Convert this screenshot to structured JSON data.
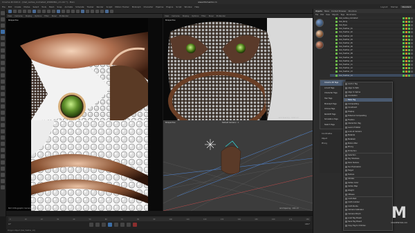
{
  "window": {
    "title": "Cinema 4D R20.0 - [Owl_Ladies_Animated_WORKING_v3.c4d *] - Main",
    "watermark_site": "www.Momentor.cn"
  },
  "menu": {
    "items": [
      "File",
      "Edit",
      "Create",
      "Modes",
      "Select",
      "Tools",
      "Mesh",
      "Snap",
      "Animate",
      "Simulate",
      "Tracker",
      "Render",
      "Sculpt",
      "Motion Tracker",
      "MoGraph",
      "Character",
      "Pipeline",
      "Plugins",
      "Script",
      "Window",
      "Help"
    ],
    "layouts": [
      "Layout:",
      "Startup",
      "Standard"
    ],
    "layout_active": "Standard"
  },
  "viewports": {
    "top_left": {
      "label": "Perspective",
      "menu": [
        "View",
        "Cameras",
        "Display",
        "Options",
        "Filter",
        "Panel",
        "ProRender"
      ]
    },
    "top_right": {
      "label": "Perspective",
      "footer": "Grid Spacing : 1000 cm"
    },
    "bottom_left": {
      "label": "Perspective",
      "footer": "Bird Orthographic Camera : 100 cm"
    },
    "bottom_right": {
      "label": "Perspective",
      "camera_label": "Default Camera :: 1",
      "footer": "Grid Spacing : 100 cm"
    }
  },
  "object_manager": {
    "tabs": [
      "Objects",
      "Takes",
      "Content Browser",
      "Structure"
    ],
    "menu": [
      "File",
      "Edit",
      "View",
      "Objects",
      "Tags",
      "Bookmarks"
    ],
    "rows": [
      {
        "name": "Owl_Ladies_Animated",
        "sel": false
      },
      {
        "name": "Owl_Body",
        "sel": false
      },
      {
        "name": "Owl_Eyes",
        "sel": false
      },
      {
        "name": "Owl_Feather_01",
        "sel": false
      },
      {
        "name": "Owl_Feather_02",
        "sel": false
      },
      {
        "name": "Owl_Feather_03",
        "sel": false
      },
      {
        "name": "Owl_Feather_04",
        "sel": false
      },
      {
        "name": "Owl_Feather_05",
        "sel": false
      },
      {
        "name": "Owl_Feather_06",
        "sel": false
      },
      {
        "name": "Owl_Feather_07",
        "sel": false
      },
      {
        "name": "Owl_Feather_08",
        "sel": false
      },
      {
        "name": "Owl_Feather_09",
        "sel": false
      },
      {
        "name": "Owl_Feather_10",
        "sel": false
      },
      {
        "name": "Owl_Feather_11",
        "sel": false
      },
      {
        "name": "Owl_Feather_12",
        "sel": false
      },
      {
        "name": "Owl_Feather_13",
        "sel": false
      },
      {
        "name": "Owl_Feather_14",
        "sel": true
      }
    ]
  },
  "attributes": {
    "submenu": [
      "Cinema 4D Tags",
      "Arnold Tags",
      "Character Tags",
      "Hair Tags",
      "MoGraph Tags",
      "Octane Tags",
      "Redshift Tags",
      "Simulation Tags",
      "Sketch Tags"
    ],
    "side_labels": [
      "Coordinates",
      "Object",
      "Phong"
    ]
  },
  "context_menu": {
    "items": [
      {
        "label": "Anchor Tag",
        "hl": false,
        "sep": false
      },
      {
        "label": "Align to Path",
        "hl": false,
        "sep": false
      },
      {
        "label": "Align to Spline",
        "hl": false,
        "sep": false
      },
      {
        "label": "Annotation",
        "hl": false,
        "sep": false
      },
      {
        "label": "Bake Tag",
        "hl": true,
        "sep": false
      },
      {
        "label": "Compositing",
        "hl": false,
        "sep": false
      },
      {
        "label": "Constraint",
        "hl": false,
        "sep": false
      },
      {
        "label": "Display",
        "hl": false,
        "sep": false
      },
      {
        "label": "External Compositing",
        "hl": false,
        "sep": false
      },
      {
        "label": "Fixation",
        "hl": false,
        "sep": false
      },
      {
        "label": "Interaction Tag",
        "hl": false,
        "sep": false
      },
      {
        "label": "Level of Detail",
        "hl": false,
        "sep": false
      },
      {
        "label": "Look at Camera",
        "hl": false,
        "sep": false
      },
      {
        "label": "Material",
        "hl": false,
        "sep": false
      },
      {
        "label": "Metaball",
        "hl": false,
        "sep": false
      },
      {
        "label": "Motion Blur",
        "hl": false,
        "sep": false
      },
      {
        "label": "Phong",
        "hl": false,
        "sep": false
      },
      {
        "label": "Protection",
        "hl": false,
        "sep": false
      },
      {
        "label": "Selection",
        "hl": false,
        "sep": true
      },
      {
        "label": "Sky Shadows",
        "hl": false,
        "sep": false
      },
      {
        "label": "Stick Texture",
        "hl": false,
        "sep": false
      },
      {
        "label": "Sun Expression",
        "hl": false,
        "sep": false
      },
      {
        "label": "Target",
        "hl": false,
        "sep": false
      },
      {
        "label": "Texture",
        "hl": false,
        "sep": false
      },
      {
        "label": "Vibrate",
        "hl": false,
        "sep": true
      },
      {
        "label": "Vertex Color",
        "hl": false,
        "sep": false
      },
      {
        "label": "Vertex Map",
        "hl": false,
        "sep": false
      },
      {
        "label": "Weight",
        "hl": false,
        "sep": false
      },
      {
        "label": "XPresso",
        "hl": false,
        "sep": false
      },
      {
        "label": "Cloth Belt",
        "hl": false,
        "sep": true
      },
      {
        "label": "Cloth Collider",
        "hl": false,
        "sep": false
      },
      {
        "label": "Cloth Nurbs",
        "hl": false,
        "sep": false
      },
      {
        "label": "Camera Calibrator",
        "hl": false,
        "sep": false
      },
      {
        "label": "Camera Morph",
        "hl": false,
        "sep": false
      },
      {
        "label": "Load Tag Preset",
        "hl": false,
        "sep": false
      },
      {
        "label": "Save Tag Preset",
        "hl": false,
        "sep": false
      },
      {
        "label": "Copy Tag to Children",
        "hl": false,
        "sep": false
      }
    ]
  },
  "timeline": {
    "ticks": [
      "0",
      "10",
      "20",
      "30",
      "40",
      "50",
      "60",
      "70",
      "80",
      "90",
      "100",
      "110",
      "120",
      "130",
      "140",
      "150",
      "160",
      "170",
      "180"
    ],
    "current_frame": "0 F",
    "end_frame": "180 F"
  },
  "status": {
    "text": "Polygon Object [Owl_Feather_14]"
  },
  "colors": {
    "accent": "#3d6ea6",
    "tag_green": "#58c04b",
    "selection": "#3c4a5e"
  }
}
